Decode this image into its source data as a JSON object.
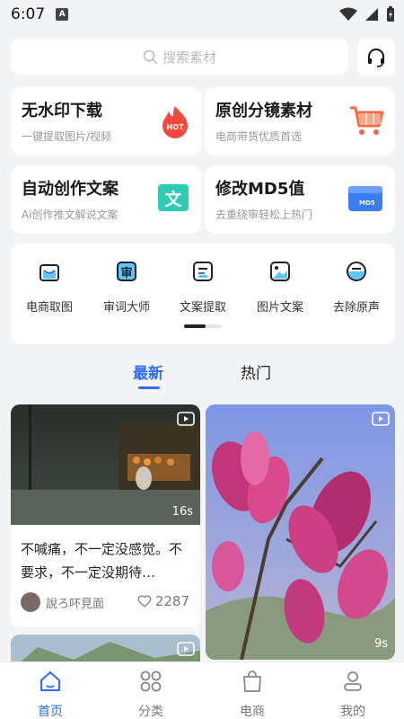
{
  "status": {
    "time": "6:07",
    "badge": "A"
  },
  "search": {
    "placeholder": "搜索素材"
  },
  "features": [
    {
      "title": "无水印下载",
      "subtitle": "一键提取图片/视频",
      "icon": "hot-flame-icon",
      "icon_text": "HOT"
    },
    {
      "title": "原创分镜素材",
      "subtitle": "电商带货优质首选",
      "icon": "cart-icon"
    },
    {
      "title": "自动创作文案",
      "subtitle": "Ai创作推文解说文案",
      "icon": "text-doc-icon",
      "icon_text": "文"
    },
    {
      "title": "修改MD5值",
      "subtitle": "去重绕审轻松上热门",
      "icon": "md5-file-icon",
      "icon_text": "MD5"
    }
  ],
  "tools": [
    {
      "label": "电商取图",
      "icon": "shopping-bag-icon"
    },
    {
      "label": "审词大师",
      "icon": "review-word-icon",
      "icon_text": "审"
    },
    {
      "label": "文案提取",
      "icon": "text-extract-icon"
    },
    {
      "label": "图片文案",
      "icon": "image-text-icon"
    },
    {
      "label": "去除原声",
      "icon": "remove-audio-icon"
    }
  ],
  "tabs": [
    {
      "label": "最新",
      "active": true
    },
    {
      "label": "热门",
      "active": false
    }
  ],
  "cards": [
    {
      "duration": "16s",
      "text": "不喊痛，不一定没感觉。不要求，不一定没期待…",
      "author": "說ろ吥見面",
      "likes": "2287"
    },
    {
      "duration": "9s"
    }
  ],
  "nav": [
    {
      "label": "首页",
      "icon": "home-icon",
      "active": true
    },
    {
      "label": "分类",
      "icon": "grid-icon",
      "active": false
    },
    {
      "label": "电商",
      "icon": "shopping-bag-icon",
      "active": false
    },
    {
      "label": "我的",
      "icon": "profile-icon",
      "active": false
    }
  ],
  "colors": {
    "accent": "#2f6bff",
    "hot": "#f44a3a",
    "cart": "#f26a45",
    "doc": "#2ccdb4",
    "md5": "#3a7df0"
  }
}
